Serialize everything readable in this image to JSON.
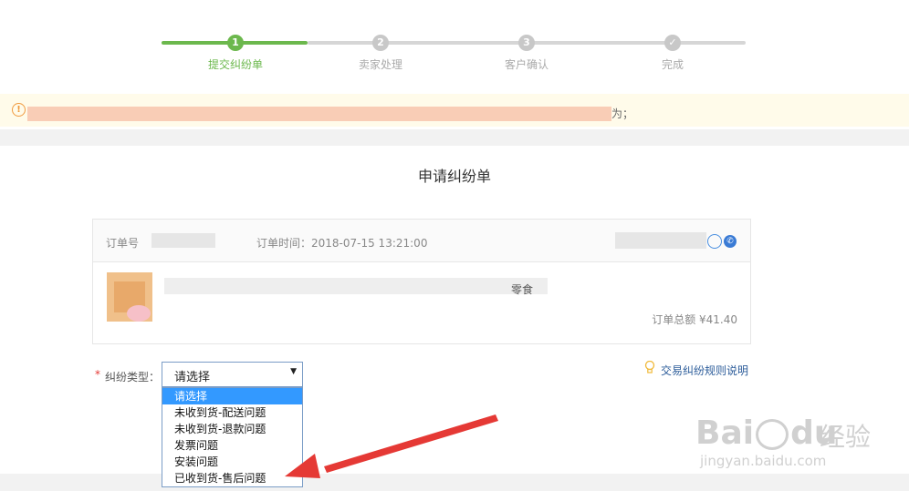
{
  "steps": [
    {
      "num": "1",
      "label": "提交纠纷单"
    },
    {
      "num": "2",
      "label": "卖家处理"
    },
    {
      "num": "3",
      "label": "客户确认"
    },
    {
      "num": "✓",
      "label": "完成"
    }
  ],
  "notice": {
    "icon": "!",
    "tail": "为；"
  },
  "page_title": "申请纠纷单",
  "order": {
    "number_label": "订单号",
    "time_label": "订单时间：2018-07-15 13:21:00",
    "total": "订单总额 ¥41.40",
    "product_tail": "零食"
  },
  "form": {
    "required_mark": "*",
    "type_label": "纠纷类型：",
    "selected": "请选择",
    "arrow": "▼",
    "options": [
      "请选择",
      "未收到货-配送问题",
      "未收到货-退款问题",
      "发票问题",
      "安装问题",
      "已收到货-售后问题"
    ]
  },
  "rule_link": "交易纠纷规则说明",
  "watermark": {
    "brand": "Bai",
    "brand2": "du",
    "cn": "经验",
    "url": "jingyan.baidu.com"
  },
  "colors": {
    "accent_green": "#6cb84d",
    "select_blue": "#3399ff",
    "arrow_red": "#e53935"
  }
}
